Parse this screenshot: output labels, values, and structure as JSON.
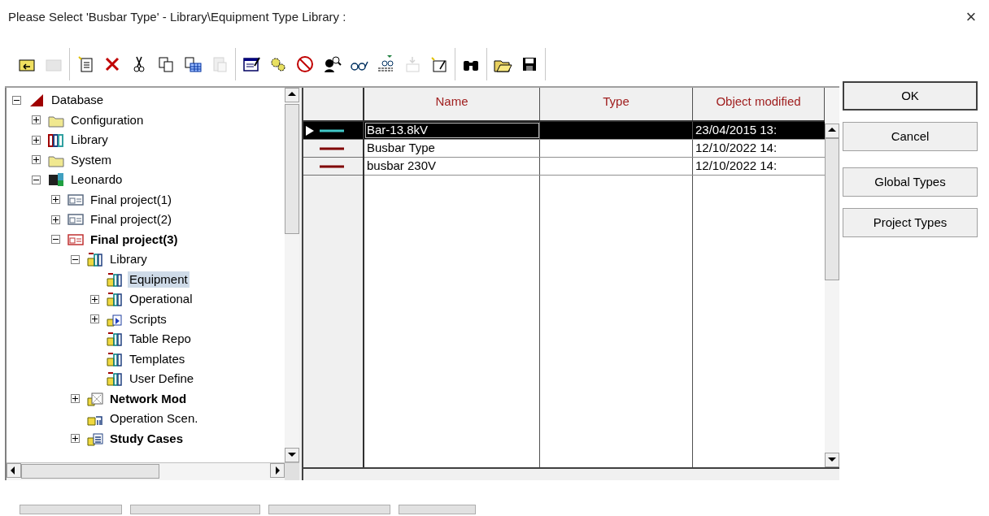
{
  "window": {
    "title": "Please Select 'Busbar Type' - Library\\Equipment Type Library :",
    "close": "×"
  },
  "toolbar": [
    [
      {
        "disabled": false
      },
      {
        "disabled": true
      }
    ],
    [
      {
        "disabled": false
      },
      {
        "disabled": false
      },
      {
        "disabled": false
      },
      {
        "disabled": false
      },
      {
        "disabled": false
      },
      {
        "disabled": true
      }
    ],
    [
      {
        "disabled": false
      },
      {
        "disabled": false
      },
      {
        "disabled": false
      },
      {
        "disabled": false
      },
      {
        "disabled": false
      },
      {
        "disabled": false
      },
      {
        "disabled": true
      },
      {
        "disabled": false
      }
    ],
    [
      {
        "disabled": false
      }
    ],
    [
      {
        "disabled": false
      },
      {
        "disabled": false
      }
    ]
  ],
  "tree": [
    {
      "label": "Database",
      "kind": "database",
      "expanded": true,
      "active": false,
      "selected": false,
      "children": [
        {
          "label": "Configuration",
          "kind": "folder",
          "expanded": false,
          "active": false,
          "selected": false
        },
        {
          "label": "Library",
          "kind": "library",
          "expanded": false,
          "active": false,
          "selected": false
        },
        {
          "label": "System",
          "kind": "folder",
          "expanded": false,
          "active": false,
          "selected": false
        },
        {
          "label": "Leonardo",
          "kind": "user",
          "expanded": true,
          "active": false,
          "selected": false,
          "children": [
            {
              "label": "Final project(1)",
              "kind": "project",
              "expanded": false,
              "active": false,
              "selected": false
            },
            {
              "label": "Final project(2)",
              "kind": "project",
              "expanded": false,
              "active": false,
              "selected": false
            },
            {
              "label": "Final project(3)",
              "kind": "project",
              "expanded": true,
              "active": true,
              "selected": false,
              "children": [
                {
                  "label": "Library",
                  "kind": "projlib",
                  "expanded": true,
                  "active": false,
                  "selected": false,
                  "children": [
                    {
                      "label": "Equipment ",
                      "kind": "projlib",
                      "active": false,
                      "selected": true
                    },
                    {
                      "label": "Operational",
                      "kind": "projlib",
                      "expanded": false,
                      "active": false,
                      "selected": false
                    },
                    {
                      "label": "Scripts",
                      "kind": "scripts",
                      "expanded": false,
                      "active": false,
                      "selected": false
                    },
                    {
                      "label": "Table Repo",
                      "kind": "projlib",
                      "active": false,
                      "selected": false
                    },
                    {
                      "label": "Templates",
                      "kind": "projlib",
                      "active": false,
                      "selected": false
                    },
                    {
                      "label": "User Define",
                      "kind": "projlib",
                      "active": false,
                      "selected": false
                    }
                  ]
                },
                {
                  "label": "Network Mod",
                  "kind": "network",
                  "expanded": false,
                  "active": true,
                  "selected": false
                },
                {
                  "label": "Operation Scen.",
                  "kind": "scenario",
                  "active": false,
                  "selected": false
                },
                {
                  "label": "Study Cases",
                  "kind": "study",
                  "expanded": false,
                  "active": true,
                  "selected": false
                }
              ]
            }
          ]
        }
      ]
    }
  ],
  "table": {
    "columns": [
      "Name",
      "Type",
      "Object modified"
    ],
    "rows": [
      {
        "name": "Bar-13.8kV",
        "type": "",
        "modified": "23/04/2015 13:",
        "color": "#40c8c8",
        "selected": true
      },
      {
        "name": "Busbar Type",
        "type": "",
        "modified": "12/10/2022 14:",
        "color": "#800000",
        "selected": false
      },
      {
        "name": "busbar 230V",
        "type": "",
        "modified": "12/10/2022 14:",
        "color": "#800000",
        "selected": false
      }
    ]
  },
  "buttons": [
    "OK",
    "Cancel",
    "Global Types",
    "Project Types"
  ]
}
